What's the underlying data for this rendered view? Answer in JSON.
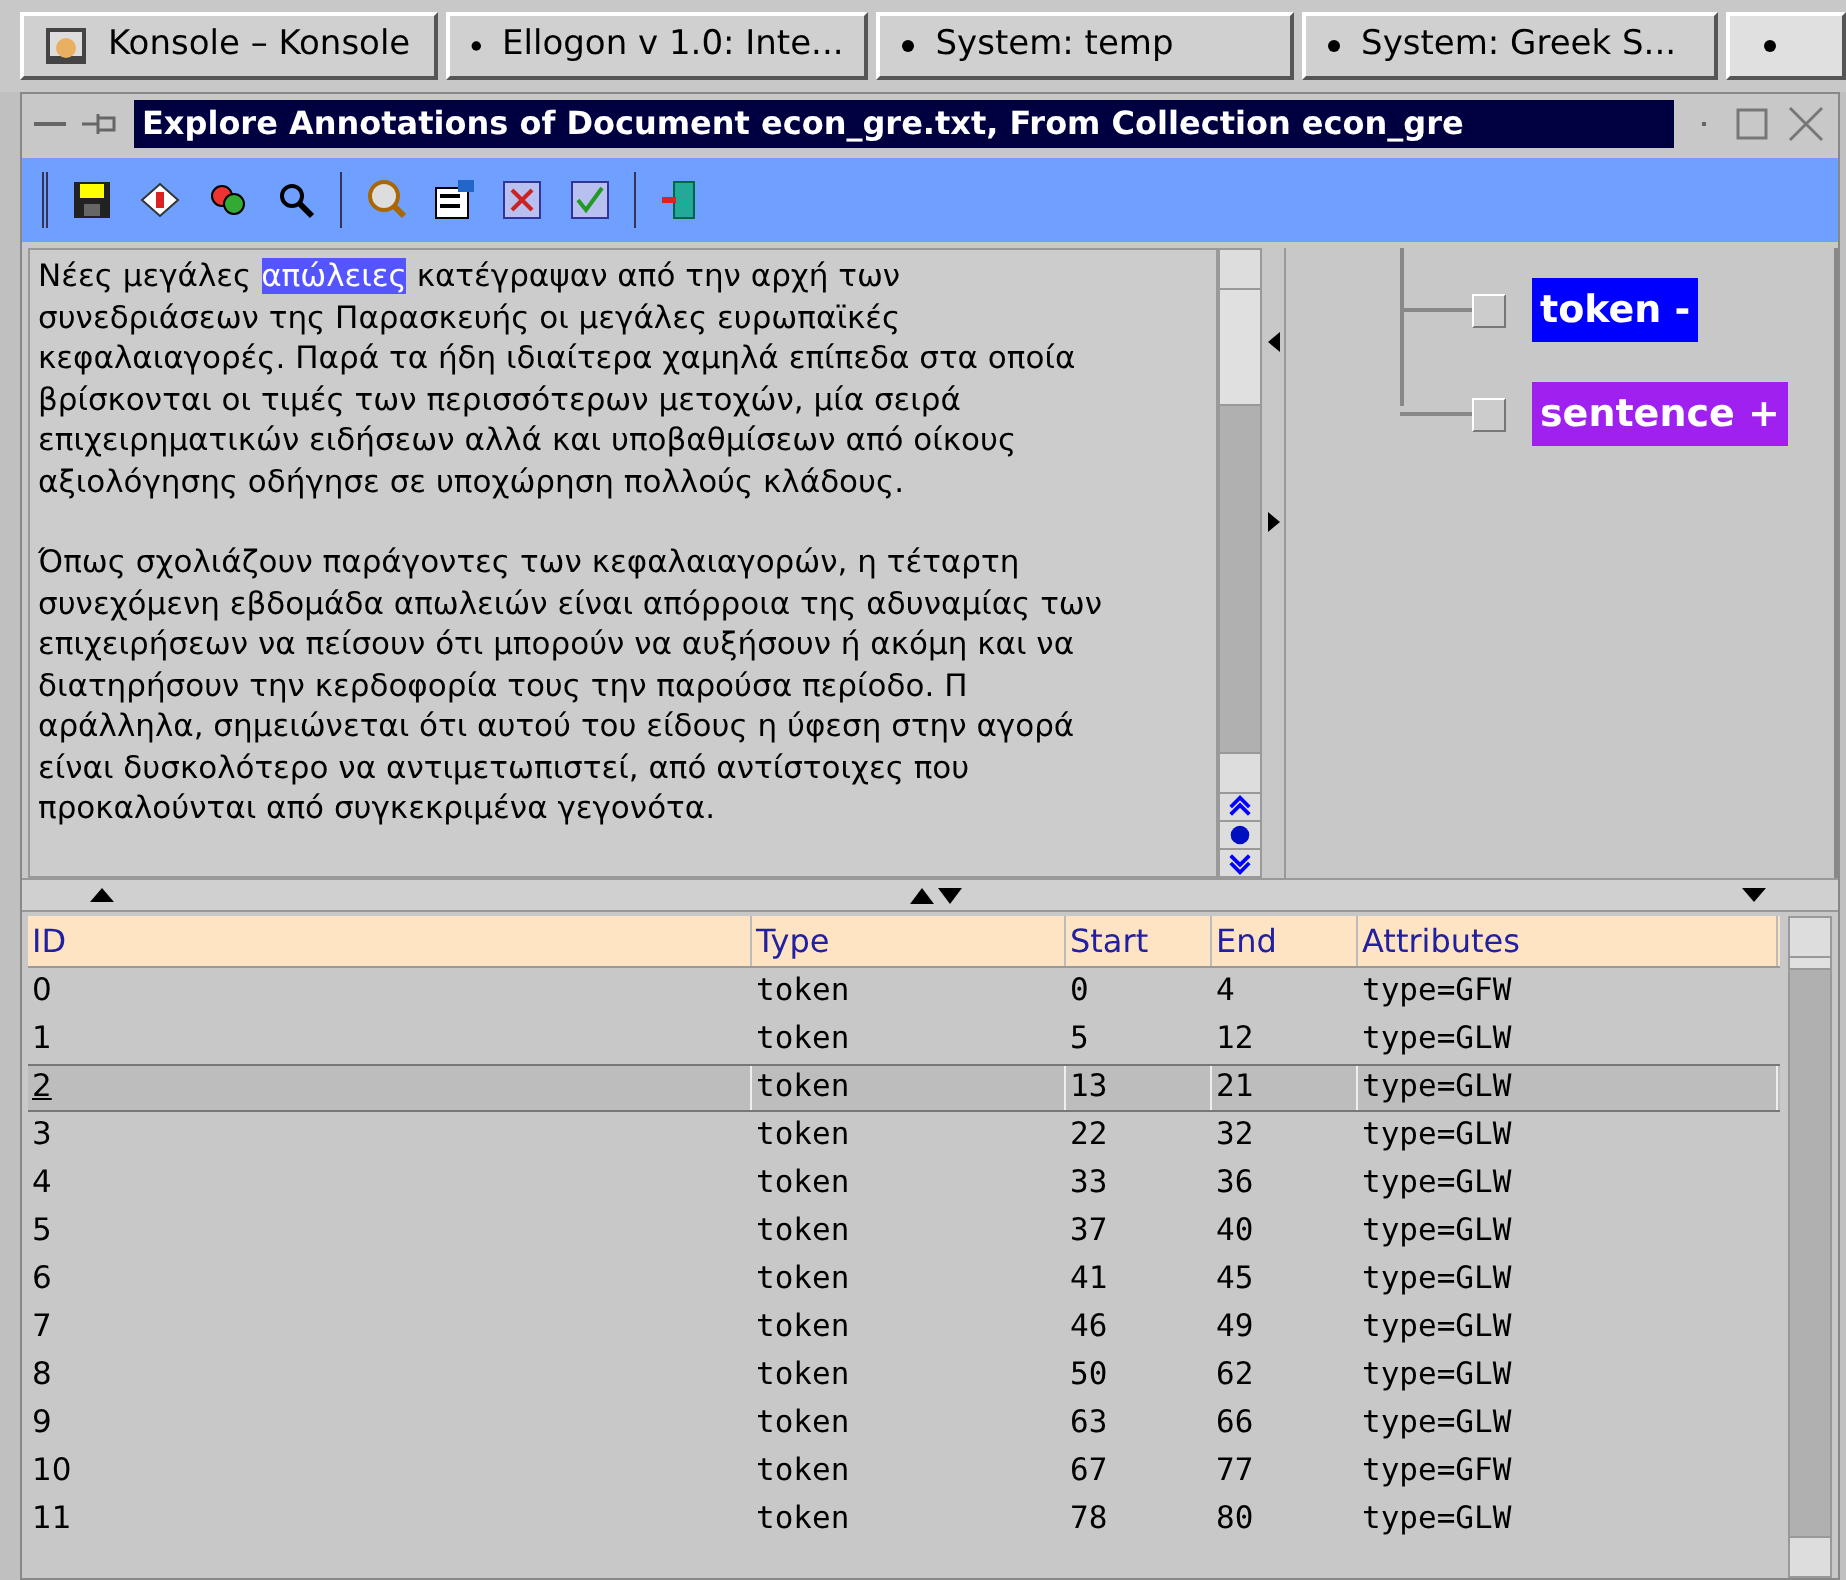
{
  "taskbar": {
    "tasks": [
      {
        "label": "Konsole – Konsole",
        "kind": "konsole",
        "selected": false
      },
      {
        "label": "Ellogon v 1.0: Inte...",
        "kind": "dot",
        "selected": false
      },
      {
        "label": "System: temp",
        "kind": "dot",
        "selected": false
      },
      {
        "label": "System: Greek S...",
        "kind": "dot",
        "selected": false
      }
    ]
  },
  "window": {
    "title": "Explore Annotations of Document econ_gre.txt, From Collection econ_gre"
  },
  "document": {
    "paragraphs": [
      [
        [
          {
            "text": "Νέες μεγάλες ",
            "selected": false
          },
          {
            "text": "απώλειες",
            "selected": true
          },
          {
            "text": " κατέγραψαν από την αρχή των",
            "selected": false
          }
        ],
        [
          {
            "text": "συνεδριάσεων της Παρασκευής οι μεγάλες ευρωπαϊκές",
            "selected": false
          }
        ],
        [
          {
            "text": "κεφαλαιαγορές. Παρά τα ήδη ιδιαίτερα χαμηλά επίπεδα στα οποία",
            "selected": false
          }
        ],
        [
          {
            "text": "βρίσκονται οι τιμές των περισσότερων μετοχών, μία σειρά",
            "selected": false
          }
        ],
        [
          {
            "text": "επιχειρηματικών ειδήσεων αλλά και υποβαθμίσεων από οίκους",
            "selected": false
          }
        ],
        [
          {
            "text": "αξιολόγησης οδήγησε σε υποχώρηση πολλούς κλάδους.",
            "selected": false
          }
        ]
      ],
      [
        [
          {
            "text": "Όπως σχολιάζουν παράγοντες των κεφαλαιαγορών, η τέταρτη",
            "selected": false
          }
        ],
        [
          {
            "text": "συνεχόμενη εβδομάδα απωλειών είναι απόρροια της αδυναμίας των",
            "selected": false
          }
        ],
        [
          {
            "text": "επιχειρήσεων να πείσουν ότι μπορούν να αυξήσουν ή ακόμη και να",
            "selected": false
          }
        ],
        [
          {
            "text": "διατηρήσουν την κερδοφορία τους την παρούσα περίοδο. Π",
            "selected": false
          }
        ],
        [
          {
            "text": "αράλληλα, σημειώνεται ότι αυτού του είδους η ύφεση στην αγορά",
            "selected": false
          }
        ],
        [
          {
            "text": "είναι δυσκολότερο να αντιμετωπιστεί, από αντίστοιχες που",
            "selected": false
          }
        ],
        [
          {
            "text": "προκαλούνται από συγκεκριμένα γεγονότα.",
            "selected": false
          }
        ]
      ]
    ]
  },
  "annotation_types": [
    {
      "label": "token -",
      "color": "#0000ff",
      "checked": false
    },
    {
      "label": "sentence +",
      "color": "#a020f0",
      "checked": false
    }
  ],
  "table": {
    "columns": [
      "ID",
      "Type",
      "Start",
      "End",
      "Attributes"
    ],
    "rows": [
      {
        "cells": [
          "0",
          "token",
          "0",
          "4",
          "type=GFW"
        ],
        "selected": false
      },
      {
        "cells": [
          "1",
          "token",
          "5",
          "12",
          "type=GLW"
        ],
        "selected": false
      },
      {
        "cells": [
          "2",
          "token",
          "13",
          "21",
          "type=GLW"
        ],
        "selected": true
      },
      {
        "cells": [
          "3",
          "token",
          "22",
          "32",
          "type=GLW"
        ],
        "selected": false
      },
      {
        "cells": [
          "4",
          "token",
          "33",
          "36",
          "type=GLW"
        ],
        "selected": false
      },
      {
        "cells": [
          "5",
          "token",
          "37",
          "40",
          "type=GLW"
        ],
        "selected": false
      },
      {
        "cells": [
          "6",
          "token",
          "41",
          "45",
          "type=GLW"
        ],
        "selected": false
      },
      {
        "cells": [
          "7",
          "token",
          "46",
          "49",
          "type=GLW"
        ],
        "selected": false
      },
      {
        "cells": [
          "8",
          "token",
          "50",
          "62",
          "type=GLW"
        ],
        "selected": false
      },
      {
        "cells": [
          "9",
          "token",
          "63",
          "66",
          "type=GLW"
        ],
        "selected": false
      },
      {
        "cells": [
          "10",
          "token",
          "67",
          "77",
          "type=GFW"
        ],
        "selected": false
      },
      {
        "cells": [
          "11",
          "token",
          "78",
          "80",
          "type=GLW"
        ],
        "selected": false
      }
    ]
  }
}
